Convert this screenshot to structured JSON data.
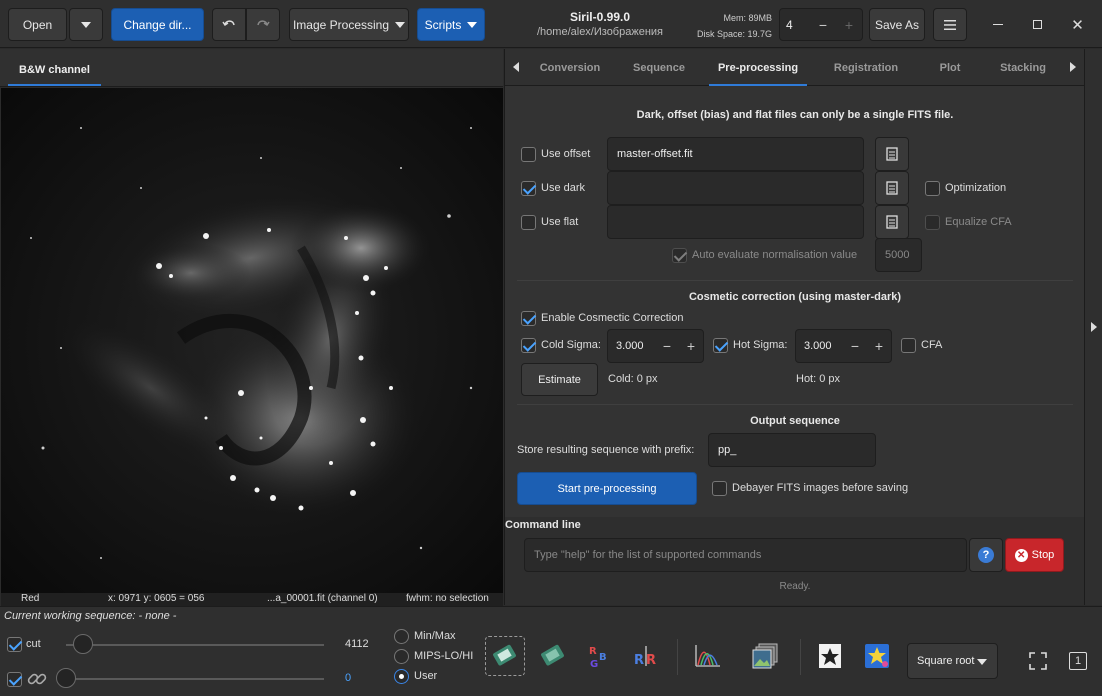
{
  "header": {
    "open_label": "Open",
    "change_dir_label": "Change dir...",
    "image_processing_label": "Image Processing",
    "scripts_label": "Scripts",
    "app_title": "Siril-0.99.0",
    "path": "/home/alex/Изображения",
    "mem_label": "Mem: 89MB",
    "disk_label": "Disk Space: 19.7G",
    "threads_value": "4",
    "save_as_label": "Save As"
  },
  "image_panel": {
    "tab_label": "B&W channel",
    "status": {
      "channel": "Red",
      "coords": "x: 0971 y: 0605 = 056",
      "file": "...a_00001.fit (channel 0)",
      "fwhm": "fwhm: no selection"
    }
  },
  "tabs": [
    "Conversion",
    "Sequence",
    "Pre-processing",
    "Registration",
    "Plot",
    "Stacking"
  ],
  "active_tab": "Pre-processing",
  "preprocessing": {
    "info_text": "Dark, offset (bias) and flat files can only be a single FITS file.",
    "use_offset_label": "Use offset",
    "use_offset_checked": false,
    "offset_file": "master-offset.fit",
    "use_dark_label": "Use dark",
    "use_dark_checked": true,
    "dark_file": "",
    "optimization_label": "Optimization",
    "optimization_checked": false,
    "use_flat_label": "Use flat",
    "use_flat_checked": false,
    "flat_file": "",
    "equalize_cfa_label": "Equalize CFA",
    "auto_eval_label": "Auto evaluate normalisation value",
    "auto_eval_checked": true,
    "norm_value": "5000",
    "cosmetic_title": "Cosmetic correction (using master-dark)",
    "enable_cosmetic_label": "Enable Cosmectic Correction",
    "enable_cosmetic_checked": true,
    "cold_sigma_label": "Cold Sigma:",
    "cold_sigma_checked": true,
    "cold_sigma_value": "3.000",
    "hot_sigma_label": "Hot Sigma:",
    "hot_sigma_checked": true,
    "hot_sigma_value": "3.000",
    "cfa_label": "CFA",
    "cfa_checked": false,
    "estimate_label": "Estimate",
    "cold_result": "Cold: 0 px",
    "hot_result": "Hot: 0 px",
    "output_title": "Output sequence",
    "prefix_label": "Store resulting sequence with prefix:",
    "prefix_value": "pp_",
    "start_label": "Start pre-processing",
    "debayer_label": "Debayer FITS images before saving",
    "debayer_checked": false
  },
  "command_line": {
    "title": "Command line",
    "placeholder": "Type \"help\" for the list of supported commands",
    "help_label": "?",
    "stop_label": "Stop",
    "status": "Ready."
  },
  "bottom": {
    "current_sequence": "Current working sequence: - none -",
    "cut_label": "cut",
    "cut_checked": true,
    "hi_value": "4112",
    "lo_value": "0",
    "link_checked": true,
    "radio_options": [
      "Min/Max",
      "MIPS-LO/HI",
      "User"
    ],
    "selected_radio": "User",
    "display_mode": "Square root",
    "one_label": "1"
  },
  "colors": {
    "accent_blue": "#1c5fb3",
    "stop_red": "#c8262b",
    "check_blue": "#4aa3ff"
  }
}
